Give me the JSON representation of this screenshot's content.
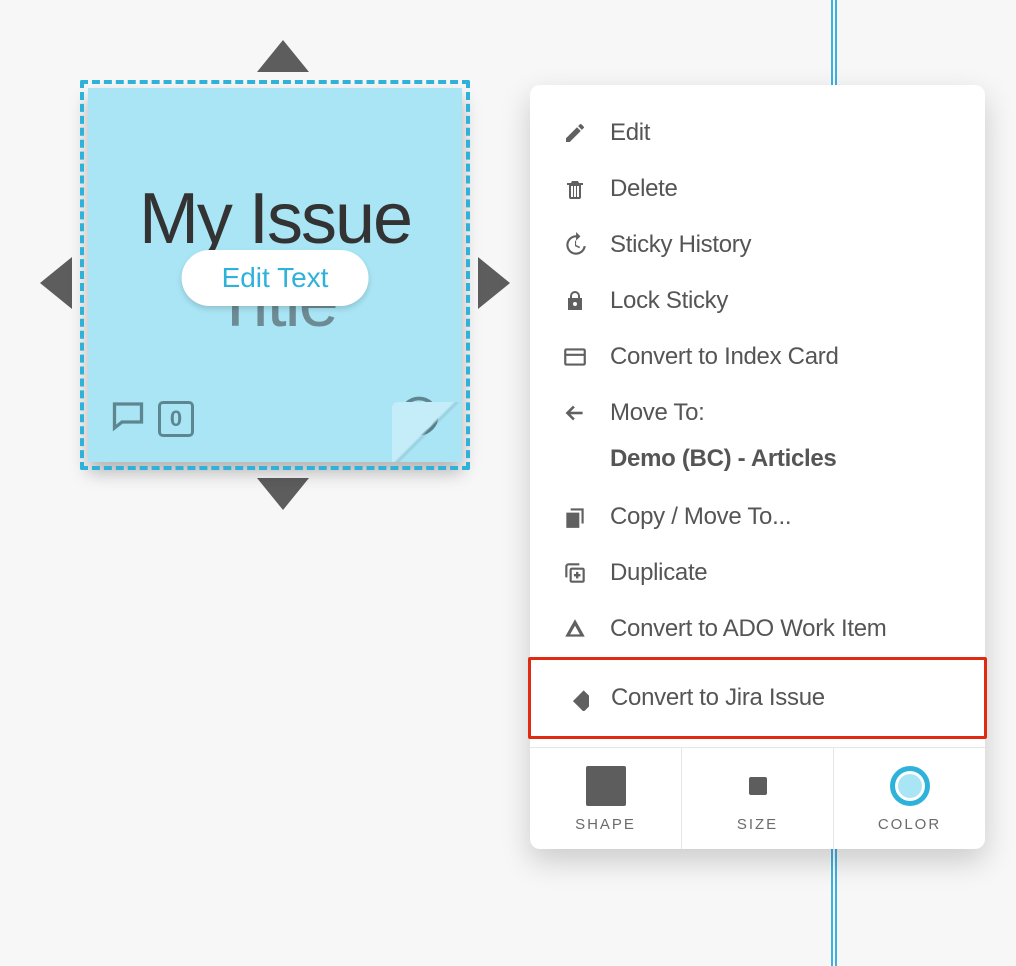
{
  "sticky": {
    "title_line1": "My Issue",
    "title_line2": "Title",
    "edit_text_label": "Edit Text",
    "vote_count": "0"
  },
  "menu": {
    "items": [
      {
        "icon": "pencil-icon",
        "label": "Edit"
      },
      {
        "icon": "trash-icon",
        "label": "Delete"
      },
      {
        "icon": "history-icon",
        "label": "Sticky History"
      },
      {
        "icon": "lock-icon",
        "label": "Lock Sticky"
      },
      {
        "icon": "card-icon",
        "label": "Convert to Index Card"
      },
      {
        "icon": "arrow-left-icon",
        "label": "Move To:"
      },
      {
        "icon": "copy-icon",
        "label": "Copy / Move To..."
      },
      {
        "icon": "duplicate-icon",
        "label": "Duplicate"
      },
      {
        "icon": "ado-icon",
        "label": "Convert to ADO Work Item"
      },
      {
        "icon": "jira-icon",
        "label": "Convert to Jira Issue"
      }
    ],
    "move_to_target": "Demo (BC) - Articles"
  },
  "footer": {
    "shape": "SHAPE",
    "size": "SIZE",
    "color": "COLOR"
  }
}
